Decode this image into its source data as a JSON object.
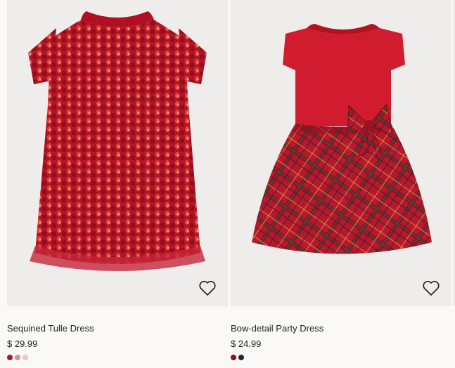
{
  "products": [
    {
      "title": "Sequined Tulle Dress",
      "price": "$ 29.99",
      "favorite_icon": "heart-outline-icon",
      "swatches": [
        "#b0142c",
        "#c89a96",
        "#e7c6c8"
      ]
    },
    {
      "title": "Bow-detail Party Dress",
      "price": "$ 24.99",
      "favorite_icon": "heart-outline-icon",
      "swatches": [
        "#7d1428",
        "#23262f"
      ]
    }
  ],
  "colors": {
    "background": "#faf9f8",
    "image_background": "#eeedec",
    "text": "#222222"
  }
}
